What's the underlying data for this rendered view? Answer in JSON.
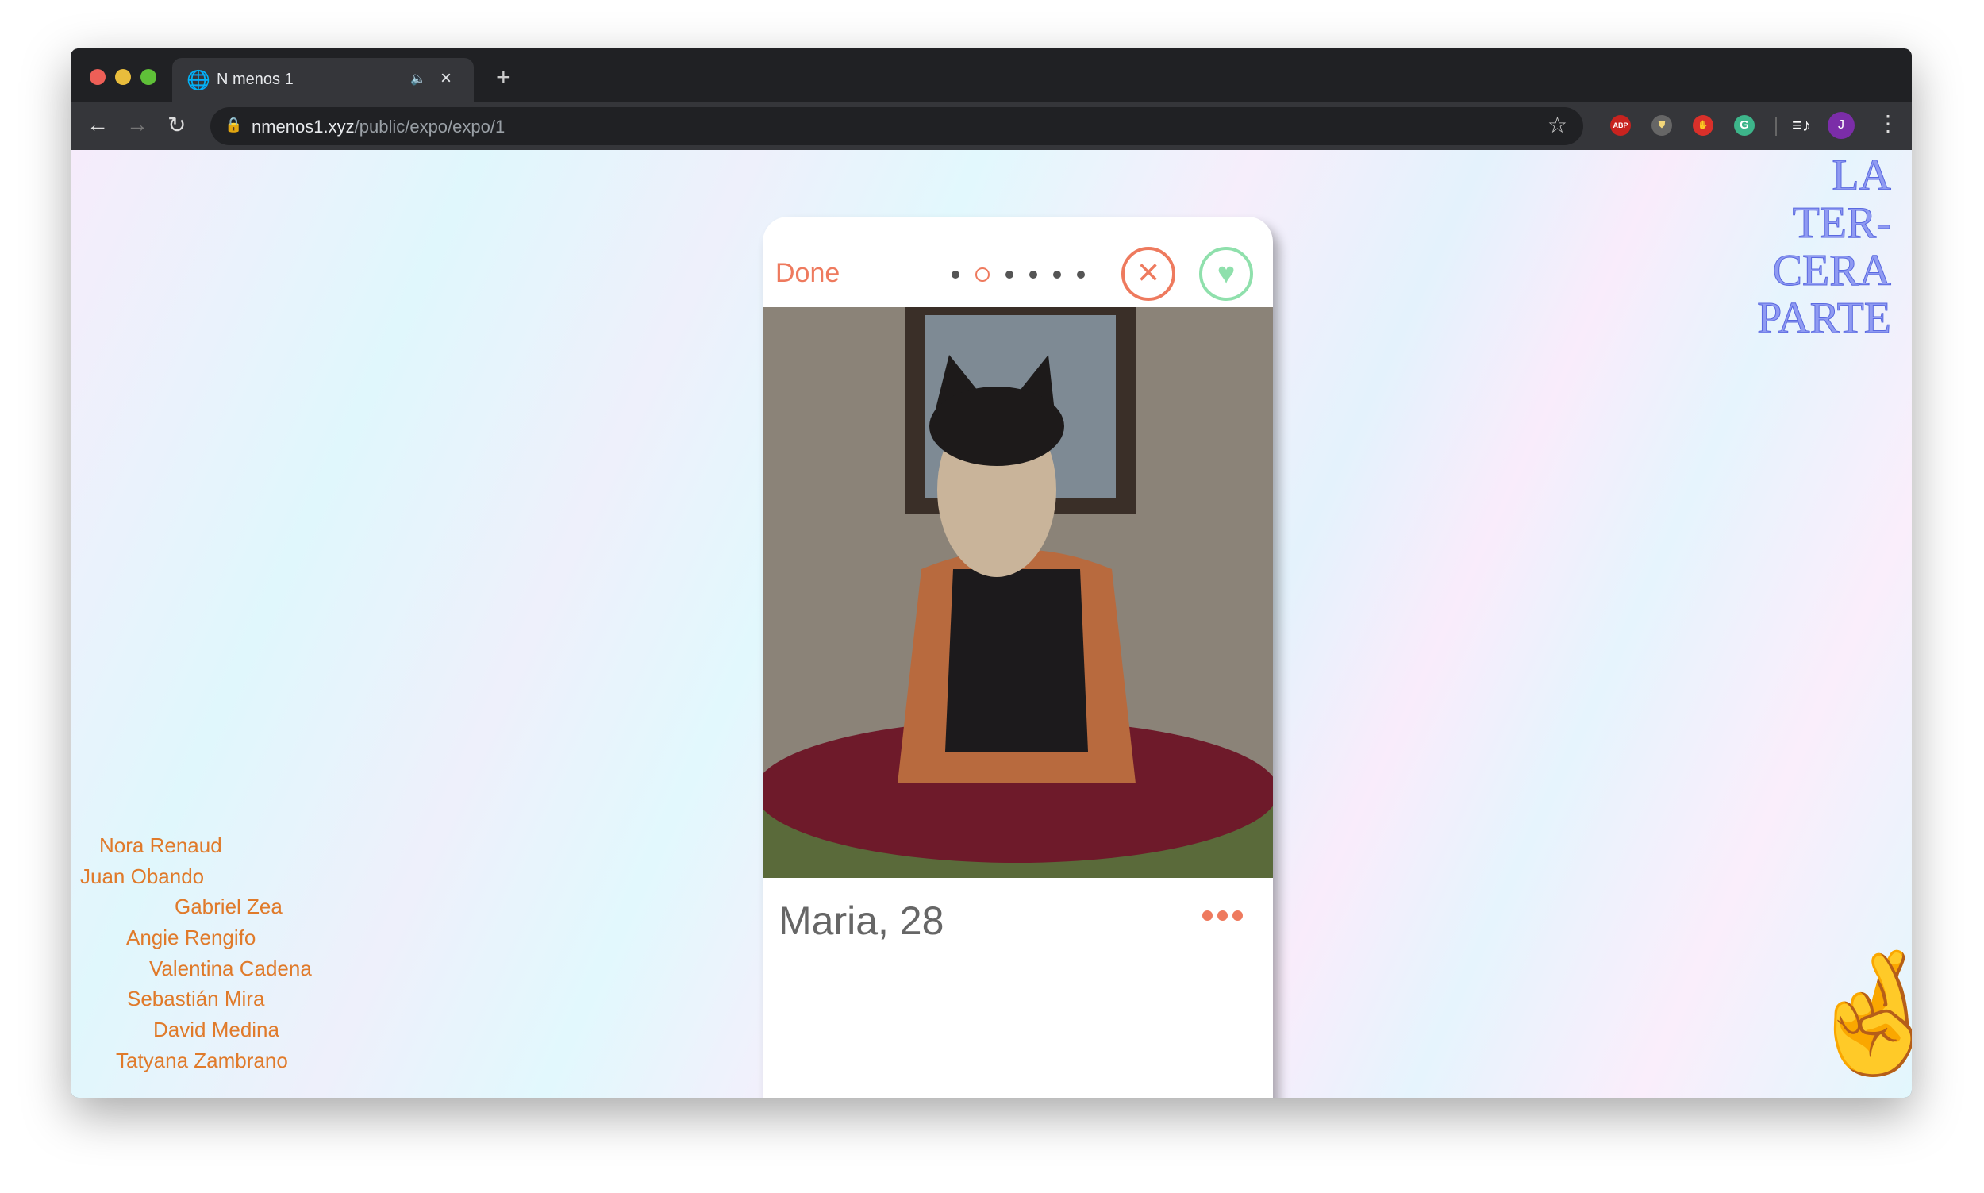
{
  "browser": {
    "tab_title": "N menos 1",
    "url_domain": "nmenos1.xyz",
    "url_path": "/public/expo/expo/1",
    "extensions": [
      "ABP",
      "shield",
      "hand",
      "G"
    ],
    "profile_initial": "J"
  },
  "card": {
    "done_label": "Done",
    "pages": 6,
    "current_page": 2,
    "profile_name": "Maria, 28",
    "colors": {
      "nope": "#ee7a5e",
      "like": "#8fe0ac"
    }
  },
  "artists": [
    "Nora Renaud",
    "Juan Obando",
    "Gabriel Zea",
    "Angie Rengifo",
    "Valentina Cadena",
    "Sebastián Mira",
    "David Medina",
    "Tatyana Zambrano"
  ],
  "title_lines": [
    "LA",
    "TER-",
    "CERA",
    "PARTE"
  ]
}
